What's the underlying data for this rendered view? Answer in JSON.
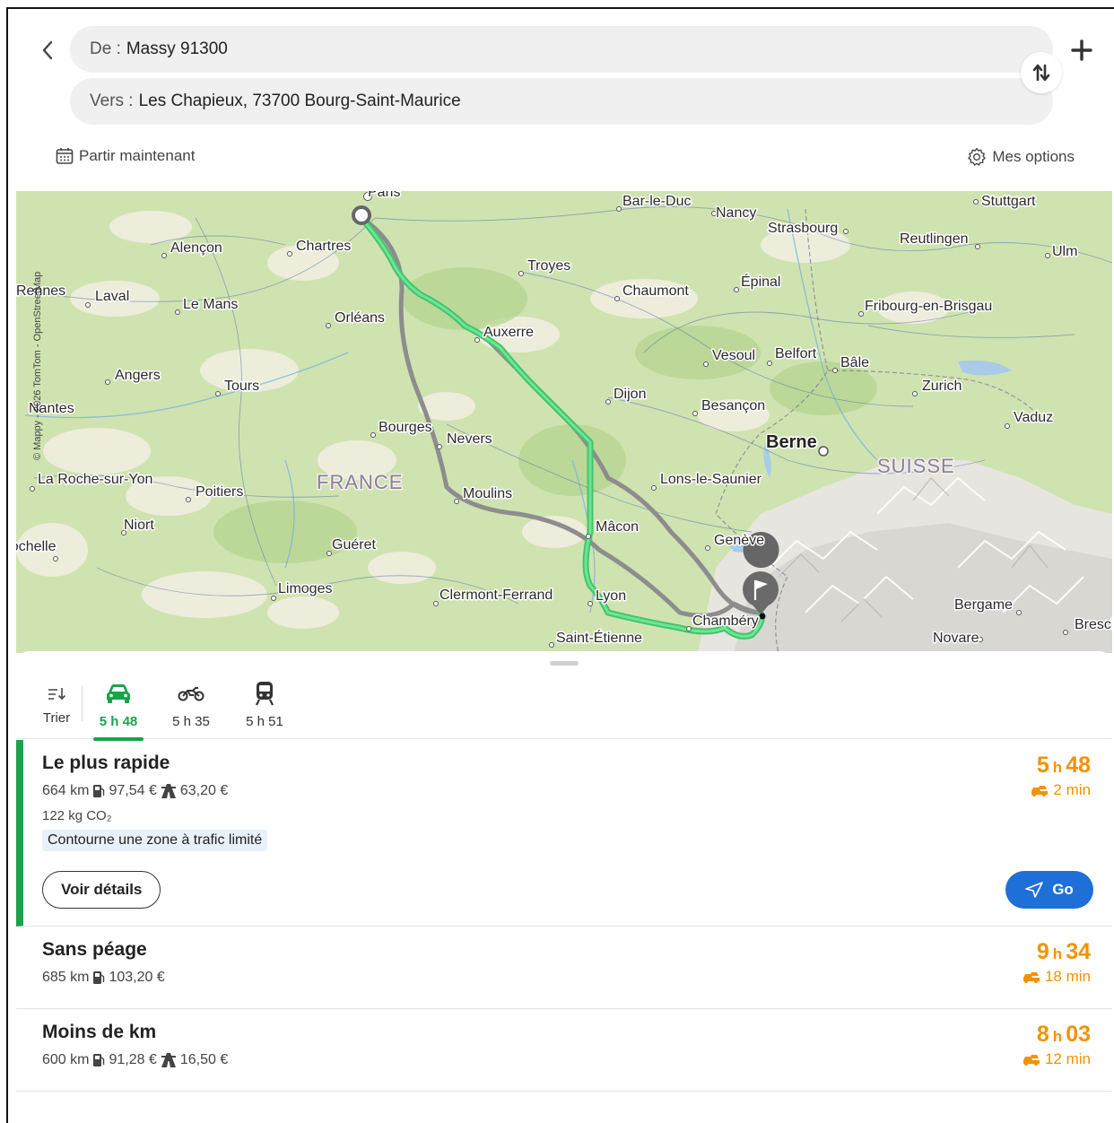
{
  "search": {
    "from_label": "De :",
    "from_value": "Massy 91300",
    "to_label": "Vers :",
    "to_value": "Les Chapieux, 73700 Bourg-Saint-Maurice"
  },
  "options": {
    "depart_label": "Partir maintenant",
    "my_options_label": "Mes options"
  },
  "map": {
    "copyright": "© Mappy - 2026 TomTom - OpenStreetMap",
    "country_labels": [
      "FRANCE",
      "SUISSE"
    ],
    "city_labels": [
      "Paris",
      "Bar-le-Duc",
      "Nancy",
      "Strasbourg",
      "Stuttgart",
      "Reutlingen",
      "Ulm",
      "Alençon",
      "Chartres",
      "Troyes",
      "Rennes",
      "Laval",
      "Le Mans",
      "Chaumont",
      "Épinal",
      "Fribourg-en-Brisgau",
      "Orléans",
      "Auxerre",
      "Vesoul",
      "Belfort",
      "Bâle",
      "Angers",
      "Tours",
      "Dijon",
      "Besançon",
      "Zurich",
      "Nantes",
      "Bourges",
      "Nevers",
      "Berne",
      "Vaduz",
      "La Roche-sur-Yon",
      "Poitiers",
      "Moulins",
      "Lons-le-Saunier",
      "Niort",
      "Mâcon",
      "La Rochelle",
      "Guéret",
      "Genève",
      "Limoges",
      "Clermont-Ferrand",
      "Lyon",
      "Chambéry",
      "Bergame",
      "Saint-Étienne",
      "Novare",
      "Brescia"
    ]
  },
  "tabs": {
    "sort_label": "Trier",
    "car_time": "5 h 48",
    "moto_time": "5 h 35",
    "train_time": "5 h 51"
  },
  "routes": [
    {
      "title": "Le plus rapide",
      "distance": "664 km",
      "fuel": "97,54 €",
      "toll": "63,20 €",
      "co2": "122 kg CO₂",
      "notice": "Contourne une zone à trafic limité",
      "hours": "5",
      "minutes": "48",
      "delay": "2 min",
      "details_label": "Voir détails",
      "go_label": "Go"
    },
    {
      "title": "Sans péage",
      "distance": "685 km",
      "fuel": "103,20 €",
      "hours": "9",
      "minutes": "34",
      "delay": "18 min"
    },
    {
      "title": "Moins de km",
      "distance": "600 km",
      "fuel": "91,28 €",
      "toll": "16,50 €",
      "hours": "8",
      "minutes": "03",
      "delay": "12 min"
    }
  ],
  "colors": {
    "primary_green": "#1aa34a",
    "route_green": "#55d57f",
    "alt_route_gray": "#8d8d8d",
    "duration_orange": "#f39200",
    "go_blue": "#1f6fd8"
  },
  "icons": [
    "chevron-left-icon",
    "plus-icon",
    "swap-icon",
    "calendar-icon",
    "gear-icon",
    "sort-icon",
    "car-icon",
    "motorbike-icon",
    "train-icon",
    "fuel-icon",
    "toll-icon",
    "traffic-car-icon",
    "navigate-icon",
    "flag-pin-icon"
  ]
}
